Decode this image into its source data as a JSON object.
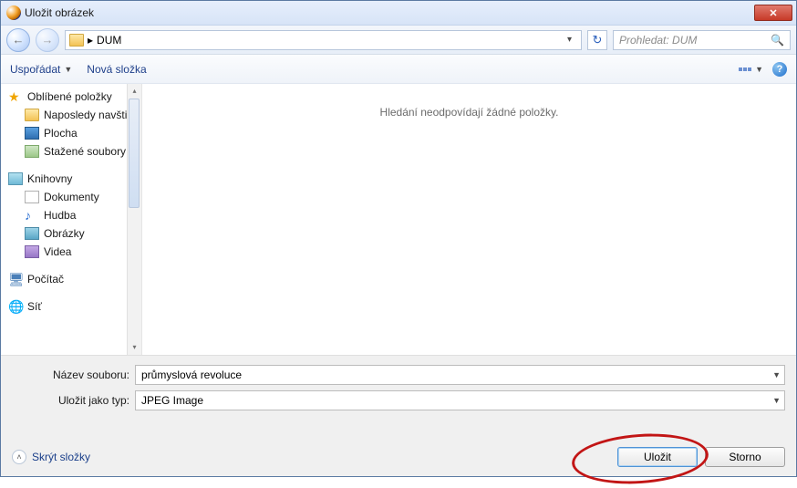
{
  "window": {
    "title": "Uložit obrázek"
  },
  "nav": {
    "path_prefix": "▸",
    "path": "DUM",
    "search_placeholder": "Prohledat: DUM"
  },
  "toolbar": {
    "organize": "Uspořádat",
    "new_folder": "Nová složka"
  },
  "tree": {
    "favorites": "Oblíbené položky",
    "recent": "Naposledy navšti",
    "desktop": "Plocha",
    "downloads": "Stažené soubory",
    "libraries": "Knihovny",
    "documents": "Dokumenty",
    "music": "Hudba",
    "pictures": "Obrázky",
    "videos": "Videa",
    "computer": "Počítač",
    "network": "Síť"
  },
  "content": {
    "empty_msg": "Hledání neodpovídají žádné položky."
  },
  "footer": {
    "filename_label": "Název souboru:",
    "filename_value": "průmyslová revoluce",
    "filetype_label": "Uložit jako typ:",
    "filetype_value": "JPEG Image",
    "hide_folders": "Skrýt složky",
    "save": "Uložit",
    "cancel": "Storno"
  }
}
